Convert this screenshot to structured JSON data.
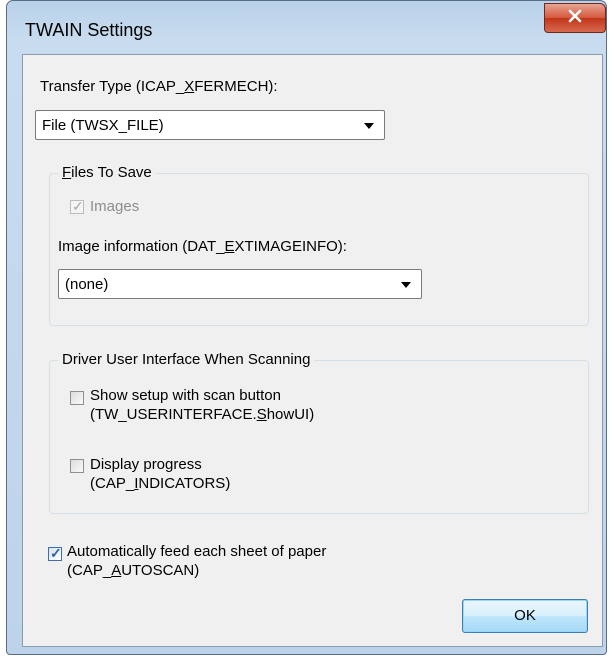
{
  "window": {
    "title": "TWAIN Settings"
  },
  "transfer": {
    "label_pre": "Transfer Type (ICAP_",
    "label_ul": "X",
    "label_post": "FERMECH):",
    "value": "File (TWSX_FILE)"
  },
  "files_group": {
    "title_ul": "F",
    "title_rest": "iles To Save",
    "images_label": "Images",
    "images_checked": true,
    "images_disabled": true,
    "info_label_pre": "Image information (DAT_",
    "info_label_ul": "E",
    "info_label_post": "XTIMAGEINFO):",
    "info_value": "(none)"
  },
  "driver_group": {
    "title": "Driver User Interface When Scanning",
    "show_setup_line1": "Show setup with scan button",
    "show_setup_line2_pre": "(TW_USERINTERFACE.",
    "show_setup_line2_ul": "S",
    "show_setup_line2_post": "howUI)",
    "show_setup_checked": false,
    "progress_line1": "Display progress",
    "progress_line2_pre": "(CAP_",
    "progress_line2_ul": "I",
    "progress_line2_post": "NDICATORS)",
    "progress_checked": false
  },
  "autofeed": {
    "line1": "Automatically feed each sheet of paper",
    "line2_pre": "(CAP_",
    "line2_ul": "A",
    "line2_post": "UTOSCAN)",
    "checked": true
  },
  "buttons": {
    "ok": "OK",
    "close_glyph": "x"
  },
  "colors": {
    "title_bar": "#c9dcef",
    "client_bg": "#f0f0f0",
    "close_red": "#c2351a",
    "check_blue": "#2a5fa6"
  }
}
